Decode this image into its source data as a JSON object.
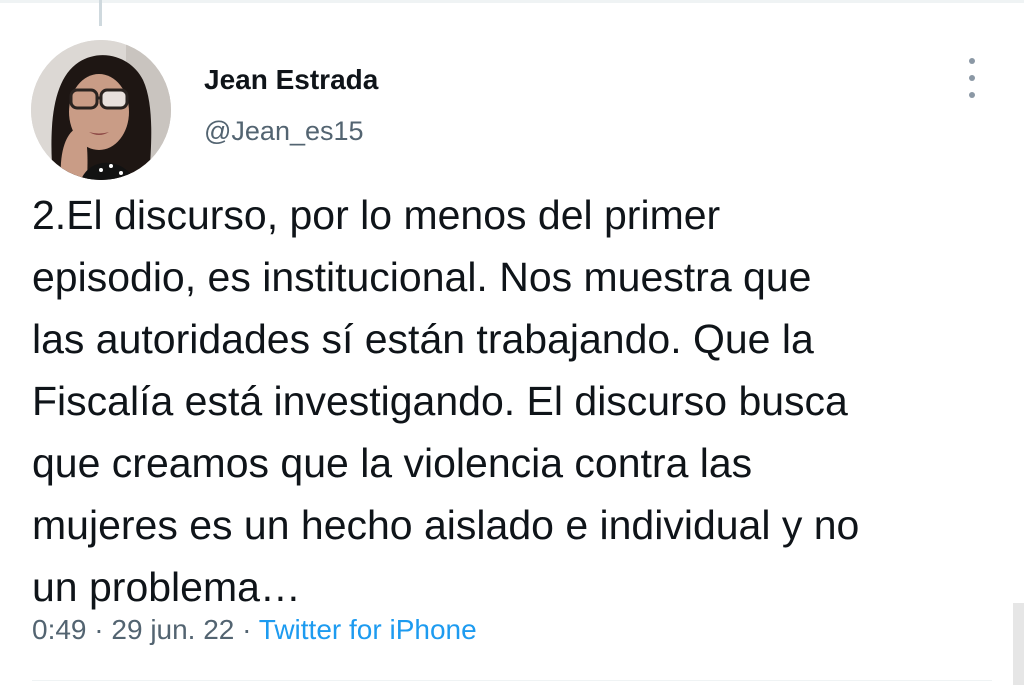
{
  "author": {
    "display_name": "Jean Estrada",
    "handle": "@Jean_es15"
  },
  "tweet": {
    "text": "2.El discurso, por lo menos del primer\nepisodio, es institucional. Nos muestra que\nlas autoridades sí están trabajando. Que la\nFiscalía está investigando. El discurso busca\nque creamos que la violencia contra las\nmujeres es un hecho aislado e individual y no\nun problema…",
    "time": "0:49",
    "separator": "·",
    "date": "29 jun. 22",
    "source": "Twitter for iPhone"
  },
  "icons": {
    "more": "more-vertical-icon"
  },
  "colors": {
    "text": "#0f1419",
    "secondary": "#536471",
    "link": "#1d9bf0"
  }
}
